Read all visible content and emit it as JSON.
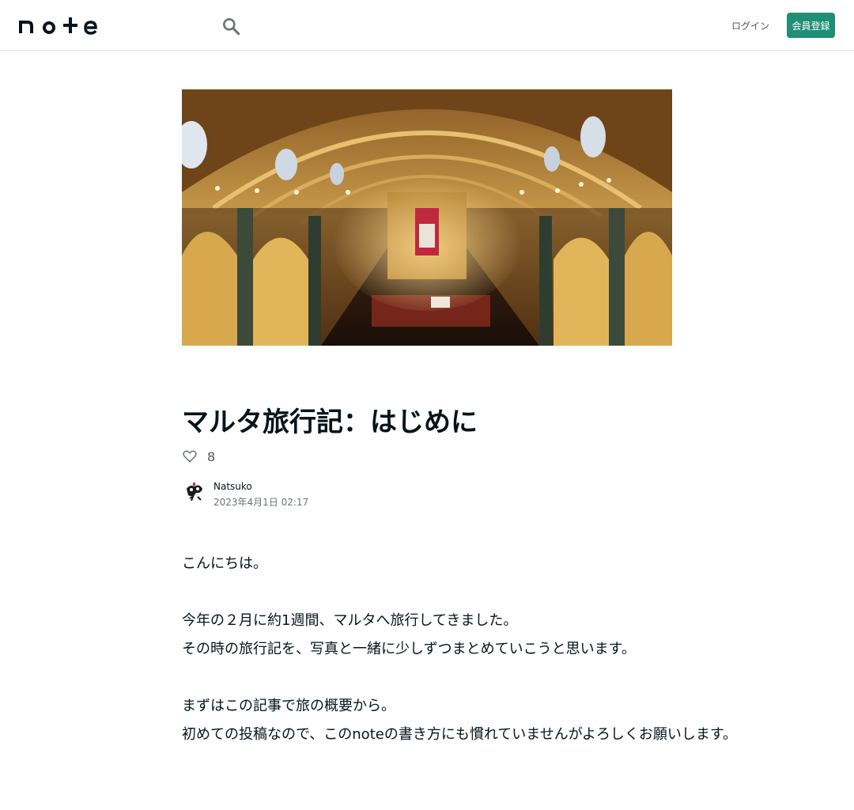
{
  "header": {
    "logo_text": "note",
    "login_label": "ログイン",
    "signup_label": "会員登録"
  },
  "article": {
    "title": "マルタ旅行記：はじめに",
    "likes": "8",
    "author_name": "Natsuko",
    "date": "2023年4月1日 02:17",
    "paragraphs": [
      "こんにちは。",
      "",
      "今年の２月に約1週間、マルタへ旅行してきました。",
      "その時の旅行記を、写真と一緒に少しずつまとめていこうと思います。",
      "",
      "まずはこの記事で旅の概要から。",
      "初めての投稿なので、このnoteの書き方にも慣れていませんがよろしくお願いします。"
    ]
  },
  "colors": {
    "accent": "#1f8f75",
    "text": "#08131a",
    "muted": "#6b7378"
  },
  "icons": [
    "search-icon",
    "heart-icon"
  ]
}
